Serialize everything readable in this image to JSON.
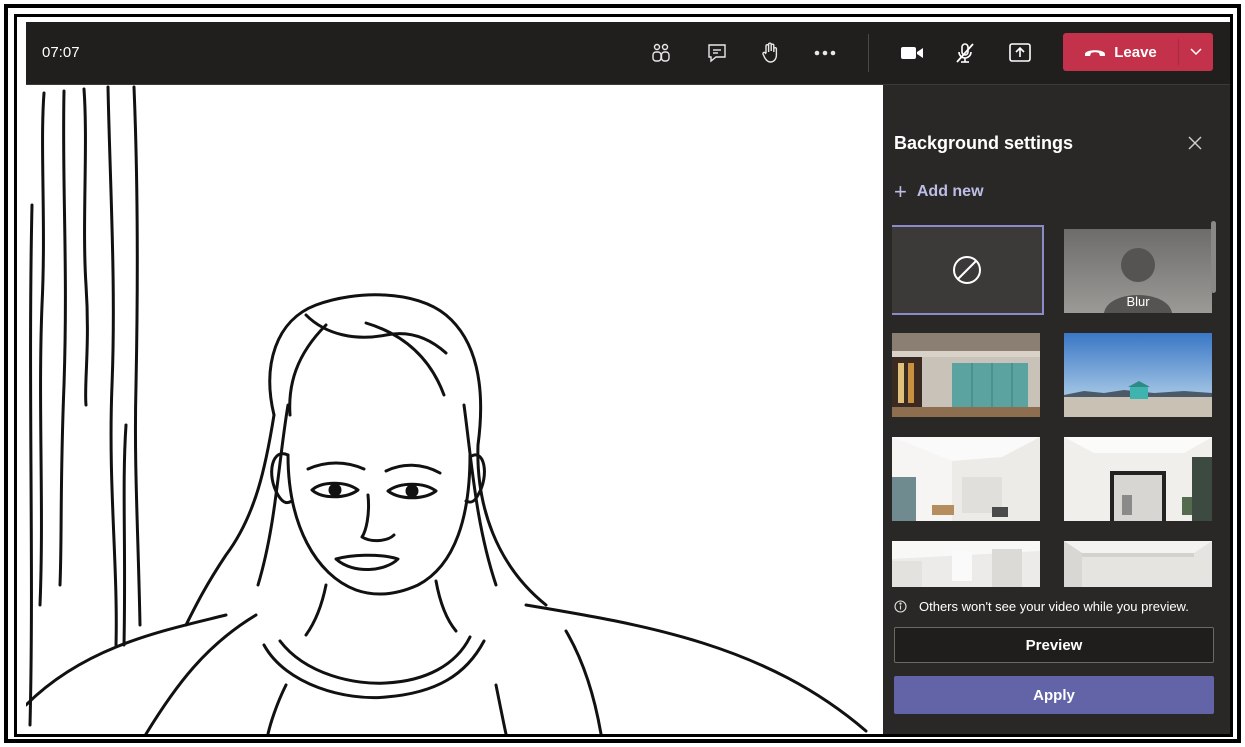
{
  "topbar": {
    "timer": "07:07",
    "icons": [
      "participants-icon",
      "chat-icon",
      "raise-hand-icon",
      "more-actions-icon",
      "camera-icon",
      "mic-muted-icon",
      "share-icon"
    ],
    "leave_label": "Leave"
  },
  "panel": {
    "title": "Background settings",
    "add_new_label": "Add new",
    "thumbnails": [
      {
        "name": "none"
      },
      {
        "name": "blur",
        "label": "Blur"
      },
      {
        "name": "office-lockers"
      },
      {
        "name": "beach"
      },
      {
        "name": "white-room-1"
      },
      {
        "name": "white-room-2"
      },
      {
        "name": "white-room-3"
      },
      {
        "name": "white-room-4"
      }
    ],
    "notice": "Others won't see your video while you preview.",
    "preview_label": "Preview",
    "apply_label": "Apply"
  },
  "colors": {
    "leave": "#c4314b",
    "apply": "#6264a7",
    "accent": "#bdbde6"
  }
}
